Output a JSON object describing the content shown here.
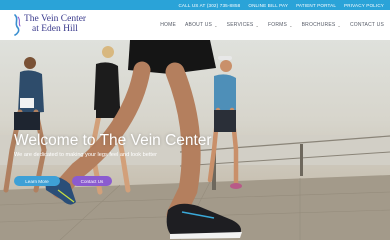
{
  "topbar": {
    "links": [
      "CALL US AT (302) 735-8858",
      "ONLINE BILL PAY",
      "PATIENT PORTAL",
      "PRIVACY POLICY"
    ]
  },
  "logo": {
    "line1": "The Vein Center",
    "line2": "at Eden Hill"
  },
  "nav": {
    "items": [
      {
        "label": "HOME",
        "dropdown": false
      },
      {
        "label": "ABOUT US",
        "dropdown": true
      },
      {
        "label": "SERVICES",
        "dropdown": true
      },
      {
        "label": "FORMS",
        "dropdown": true
      },
      {
        "label": "BROCHURES",
        "dropdown": true
      },
      {
        "label": "CONTACT US",
        "dropdown": false
      }
    ]
  },
  "hero": {
    "title": "Welcome to The Vein Center",
    "subtitle": "We are dedicated to making your legs feel and look better",
    "learn_label": "Learn More",
    "contact_label": "Contact Us"
  },
  "colors": {
    "topbar": "#2aa3d8",
    "logo_text": "#3a3a8c",
    "learn_button": "#3ea0d6",
    "contact_button": "#8b5bd0"
  }
}
